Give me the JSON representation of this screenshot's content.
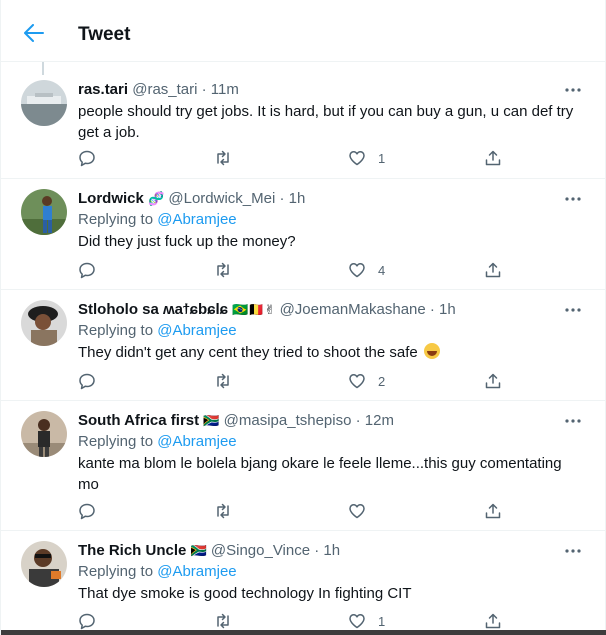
{
  "header": {
    "title": "Tweet"
  },
  "colors": {
    "accent": "#1d9bf0",
    "text": "#0f1419",
    "muted": "#536471",
    "border": "#eff3f4"
  },
  "tweets": [
    {
      "name": "ras.tari",
      "handle": "@ras_tari",
      "time": "· 11m",
      "replying_prefix": "",
      "replying_to": "",
      "text": "people should try get jobs. It is hard, but if you can buy a gun, u can def try get a job.",
      "likes": "1"
    },
    {
      "name": "Lordwick",
      "name_emoji": "🧬",
      "handle": "@Lordwick_Mei",
      "time": "· 1h",
      "replying_prefix": "Replying to",
      "replying_to": "@Abramjee",
      "text": "Did they just fuck up the money?",
      "likes": "4"
    },
    {
      "name": "Stloholo sa ʍaϯɕbɕlɕ",
      "name_emoji": "🇧🇷🇧🇪✌",
      "handle": "@JoemanMakashane",
      "time": "· 1h",
      "replying_prefix": "Replying to",
      "replying_to": "@Abramjee",
      "text": "They didn't get any cent they tried to shoot the safe",
      "likes": "2"
    },
    {
      "name": "South Africa first",
      "name_emoji": "🇿🇦",
      "handle": "@masipa_tshepiso",
      "time": "· 12m",
      "replying_prefix": "Replying to",
      "replying_to": "@Abramjee",
      "text": "kante ma blom le bolela bjang okare le feele lleme...this guy comentating mo",
      "likes": ""
    },
    {
      "name": "The Rich Uncle",
      "name_emoji": "🇿🇦",
      "handle": "@Singo_Vince",
      "time": "· 1h",
      "replying_prefix": "Replying to",
      "replying_to": "@Abramjee",
      "text": "That dye smoke is good technology In fighting CIT",
      "likes": "1"
    }
  ],
  "icons": {
    "back": "arrow-left-icon",
    "more": "more-horizontal-icon",
    "reply": "reply-icon",
    "retweet": "retweet-icon",
    "like": "heart-icon",
    "share": "share-icon"
  }
}
